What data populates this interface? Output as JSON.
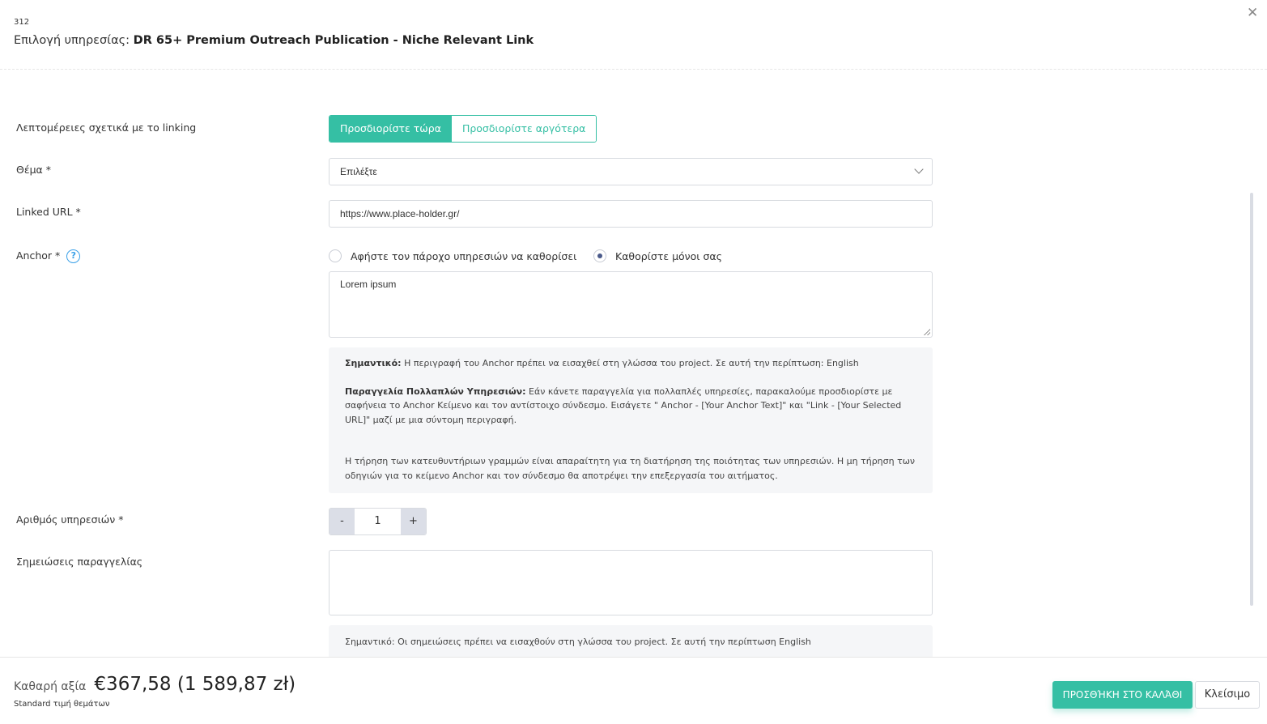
{
  "header": {
    "id": "312",
    "title_prefix": "Επιλογή υπηρεσίας:",
    "title_service": "DR 65+ Premium Outreach Publication - Niche Relevant Link",
    "close_icon": "close-icon"
  },
  "form": {
    "linking": {
      "label": "Λεπτομέρειες σχετικά με το linking",
      "options": [
        "Προσδιορίστε τώρα",
        "Προσδιορίστε αργότερα"
      ],
      "selected": "Προσδιορίστε τώρα"
    },
    "topic": {
      "label": "Θέμα *",
      "value": "Επιλέξτε"
    },
    "url": {
      "label": "Linked URL *",
      "value": "https://www.place-holder.gr/"
    },
    "anchor": {
      "label": "Anchor *",
      "help_icon": "?",
      "options": [
        "Αφήστε τον πάροχο υπηρεσιών να καθορίσει",
        "Καθορίστε μόνοι σας"
      ],
      "selected": "Καθορίστε μόνοι σας",
      "value": "Lorem ipsum"
    },
    "anchor_note": {
      "important_label": "Σημαντικό:",
      "important_text": " Η περιγραφή του Anchor πρέπει να εισαχθεί στη γλώσσα του project. Σε αυτή την περίπτωση: English",
      "multi_label": "Παραγγελία Πολλαπλών Υπηρεσιών:",
      "multi_text": " Εάν κάνετε παραγγελία για πολλαπλές υπηρεσίες, παρακαλούμε προσδιορίστε με σαφήνεια το Anchor Κείμενο και τον αντίστοιχο σύνδεσμο. Εισάγετε \" Anchor - [Your Anchor Text]\" και \"Link - [Your Selected URL]\" μαζί με μια σύντομη περιγραφή.",
      "guidelines": "Η τήρηση των κατευθυντήριων γραμμών είναι απαραίτητη για τη διατήρηση της ποιότητας των υπηρεσιών. Η μη τήρηση των οδηγιών για το κείμενο Anchor και τον σύνδεσμο θα αποτρέψει την επεξεργασία του αιτήματος."
    },
    "quantity": {
      "label": "Αριθμός υπηρεσιών *",
      "minus": "-",
      "value": "1",
      "plus": "+"
    },
    "notes": {
      "label": "Σημειώσεις παραγγελίας",
      "value": ""
    },
    "notes_note": "Σημαντικό: Οι σημειώσεις πρέπει να εισαχθούν στη γλώσσα του project. Σε αυτή την περίπτωση English"
  },
  "footer": {
    "net_label": "Καθαρή αξία",
    "price": "€367,58 (1 589,87 zł)",
    "sub": "Standard τιμή θεμάτων",
    "add_button": "ΠΡΟΣΘΉΚΗ ΣΤΟ ΚΑΛΆΘΙ",
    "close_button": "Κλείσιμο"
  },
  "colors": {
    "accent": "#35bfa4",
    "help": "#3aa0e8"
  }
}
